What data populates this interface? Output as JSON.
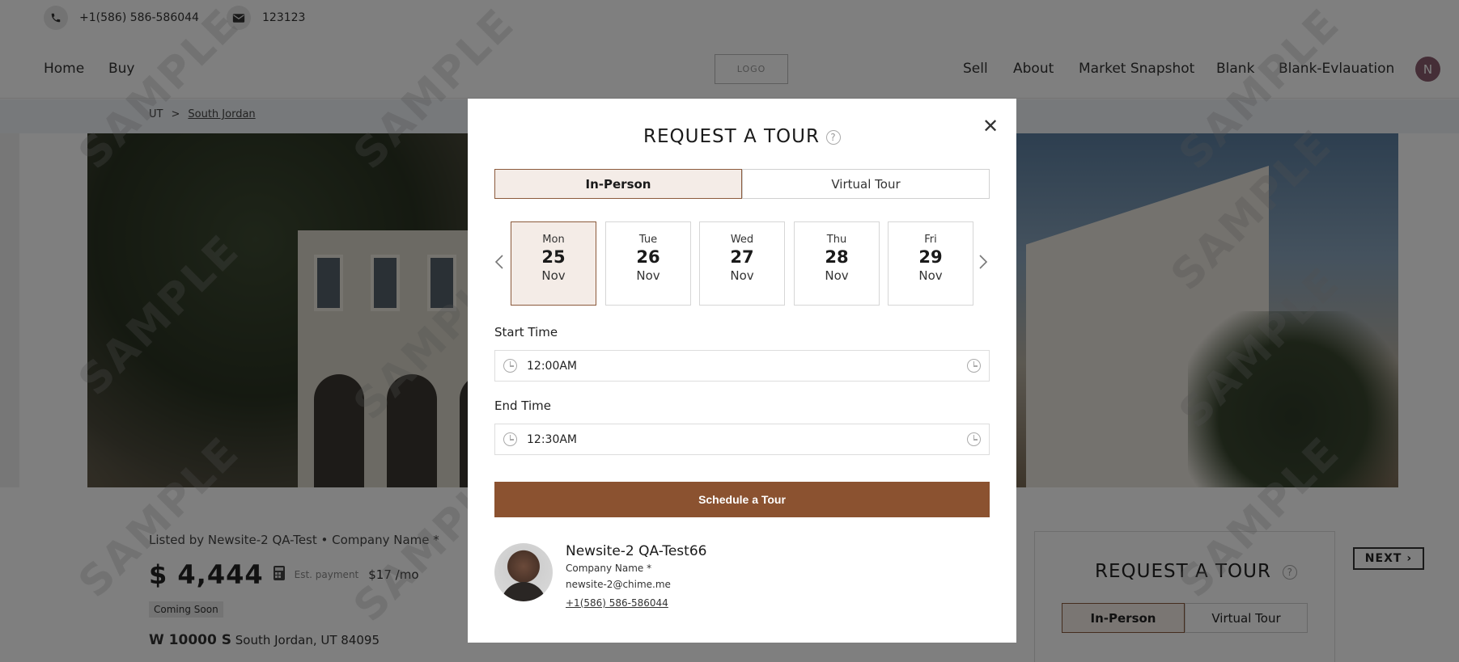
{
  "topbar": {
    "phone": "+1(586) 586-586044",
    "email": "123123"
  },
  "nav": {
    "left": [
      "Home",
      "Buy"
    ],
    "logo": "LOGO",
    "right": [
      "Sell",
      "About",
      "Market Snapshot",
      "Blank",
      "Blank-Evlauation"
    ],
    "avatar_initial": "N"
  },
  "breadcrumb": {
    "state": "UT",
    "separator": ">",
    "city": "South Jordan"
  },
  "listing": {
    "listed_by": "Listed by Newsite-2 QA-Test • Company Name *",
    "price": "$ 4,444",
    "est_payment_label": "Est. payment",
    "est_payment_value": "$17 /mo",
    "status_badge": "Coming Soon",
    "street": "W 10000 S",
    "city_line": "South Jordan, UT 84095"
  },
  "side_card": {
    "title": "REQUEST A TOUR",
    "tab_in_person": "In-Person",
    "tab_virtual": "Virtual Tour",
    "next_label": "NEXT"
  },
  "watermark_text": "SAMPLE",
  "modal": {
    "title": "REQUEST A TOUR",
    "help_glyph": "?",
    "close_glyph": "✕",
    "tabs": [
      {
        "label": "In-Person",
        "active": true
      },
      {
        "label": "Virtual Tour",
        "active": false
      }
    ],
    "dates": [
      {
        "dow": "Mon",
        "day": "25",
        "month": "Nov",
        "active": true
      },
      {
        "dow": "Tue",
        "day": "26",
        "month": "Nov",
        "active": false
      },
      {
        "dow": "Wed",
        "day": "27",
        "month": "Nov",
        "active": false
      },
      {
        "dow": "Thu",
        "day": "28",
        "month": "Nov",
        "active": false
      },
      {
        "dow": "Fri",
        "day": "29",
        "month": "Nov",
        "active": false
      }
    ],
    "start_time_label": "Start Time",
    "start_time": "12:00AM",
    "end_time_label": "End Time",
    "end_time": "12:30AM",
    "schedule_button": "Schedule a Tour",
    "agent": {
      "name": "Newsite-2 QA-Test66",
      "company": "Company Name *",
      "email": "newsite-2@chime.me",
      "phone": "+1(586) 586-586044"
    }
  },
  "colors": {
    "accent": "#8b5230",
    "active_bg": "#f4ece7",
    "active_border": "#8b5a3c",
    "overlay": "rgba(0,0,0,0.5)"
  }
}
